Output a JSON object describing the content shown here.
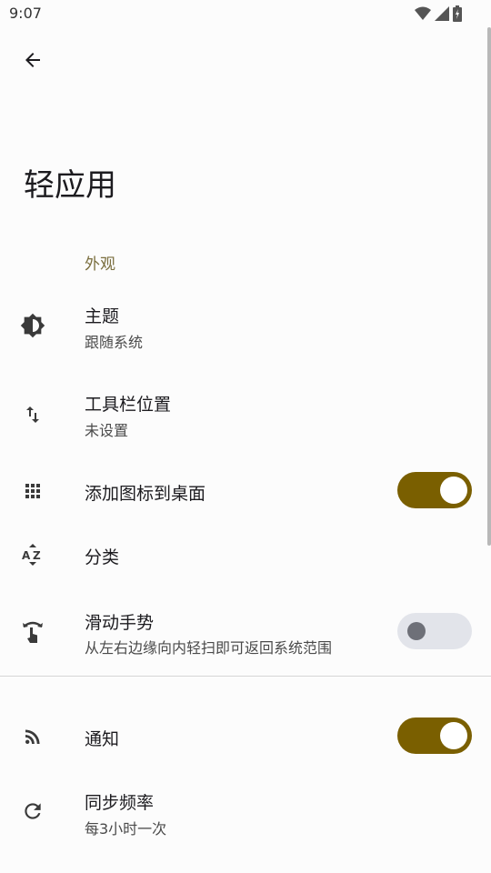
{
  "status_bar": {
    "time": "9:07"
  },
  "header": {
    "title": "轻应用"
  },
  "section": {
    "appearance_label": "外观"
  },
  "settings": {
    "theme": {
      "title": "主题",
      "subtitle": "跟随系统",
      "icon": "theme-icon"
    },
    "toolbar_position": {
      "title": "工具栏位置",
      "subtitle": "未设置",
      "icon": "swap-vertical-icon"
    },
    "add_icon": {
      "title": "添加图标到桌面",
      "toggle": true,
      "icon": "apps-grid-icon"
    },
    "category": {
      "title": "分类",
      "icon": "sort-az-icon"
    },
    "swipe_gesture": {
      "title": "滑动手势",
      "subtitle": "从左右边缘向内轻扫即可返回系统范围",
      "toggle": false,
      "icon": "swipe-gesture-icon"
    },
    "notification": {
      "title": "通知",
      "toggle": true,
      "icon": "rss-feed-icon"
    },
    "sync_frequency": {
      "title": "同步频率",
      "subtitle": "每3小时一次",
      "icon": "sync-icon"
    }
  },
  "colors": {
    "accent": "#7a5f00",
    "section_header": "#7a6e3e",
    "background": "#fcfcfc"
  }
}
